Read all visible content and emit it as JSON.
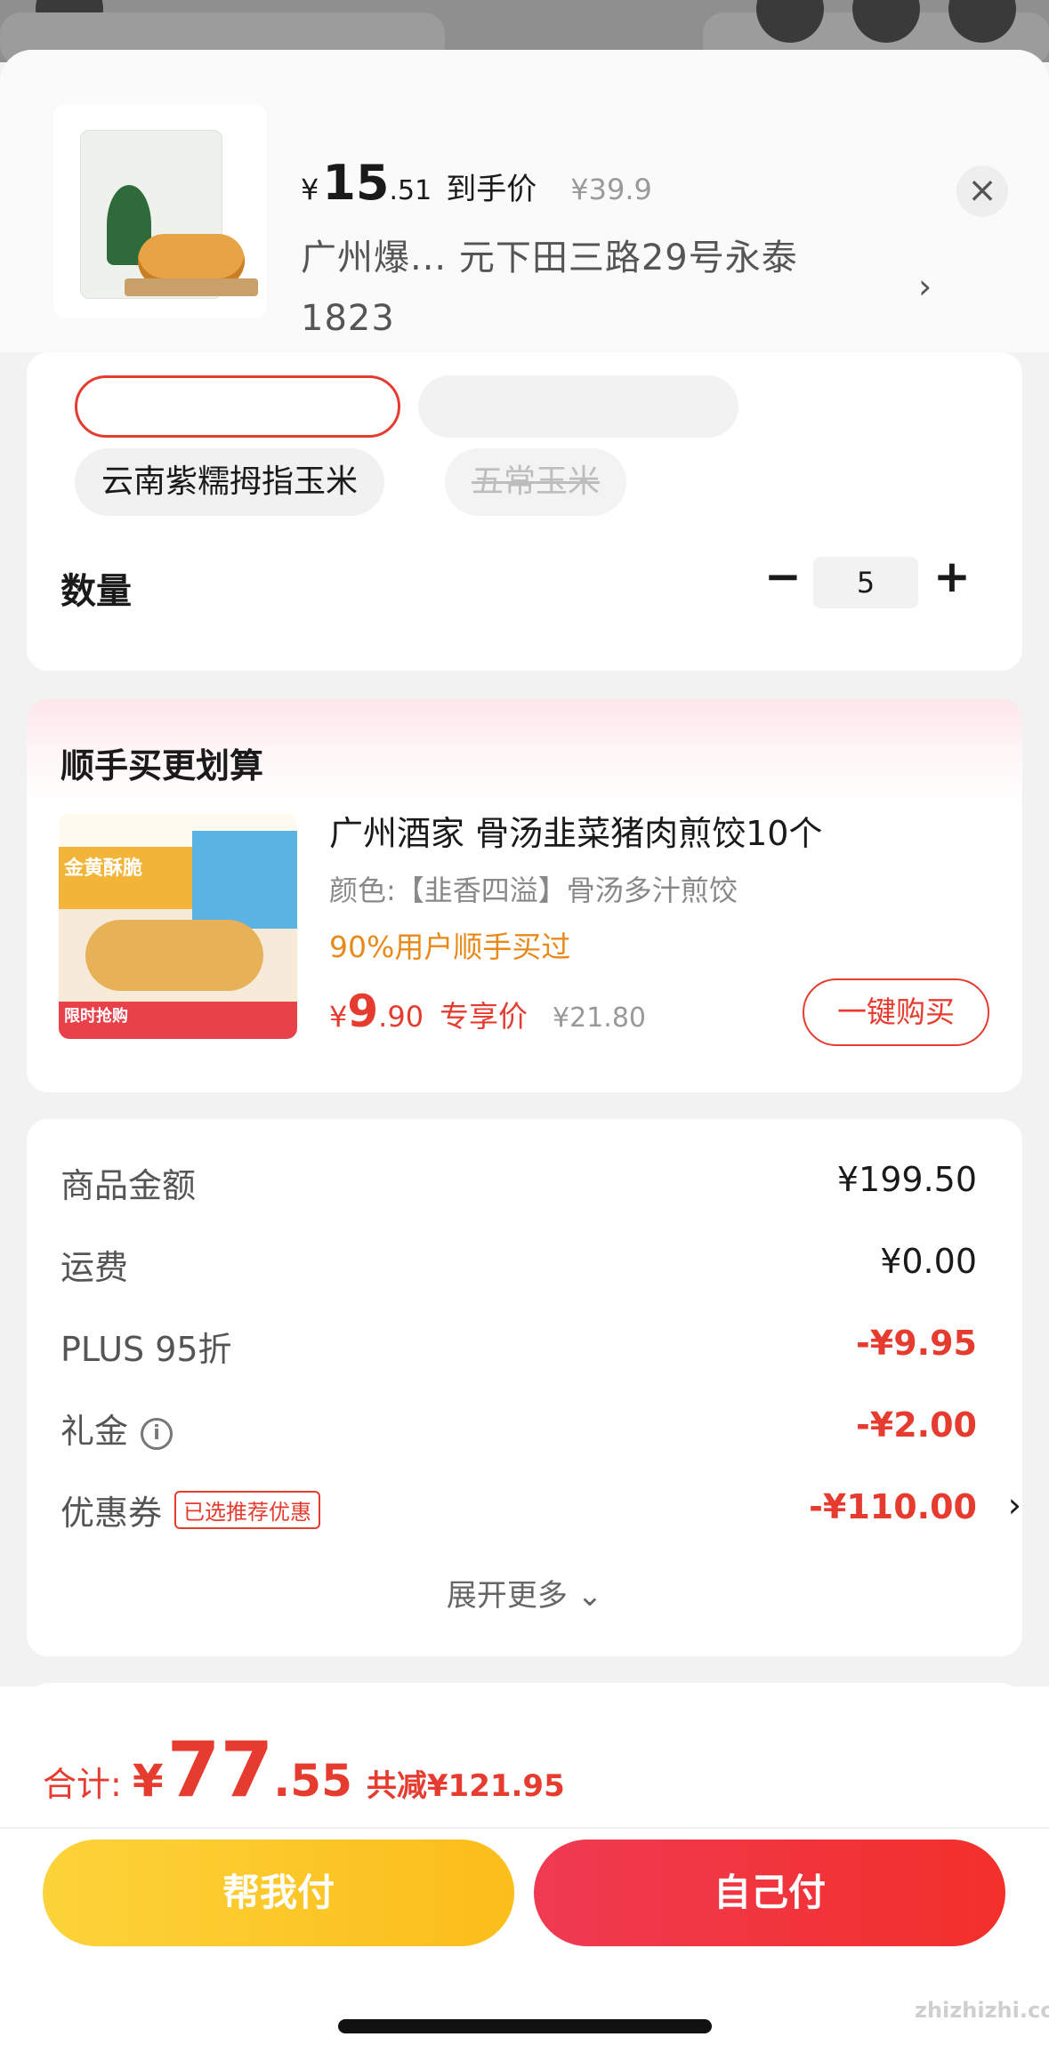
{
  "header": {
    "price_symbol": "¥",
    "price_int": "15",
    "price_dec": ".51",
    "price_tag": "到手价",
    "orig_price": "¥39.9",
    "address": "广州爆...  元下田三路29号永泰1823",
    "close": "×",
    "chevron": "›"
  },
  "spec": {
    "options": [
      {
        "label": "云南紫糯拇指玉米",
        "disabled": false
      },
      {
        "label": "五常玉米",
        "disabled": true
      }
    ],
    "qty_label": "数量",
    "qty_minus": "−",
    "qty_value": "5",
    "qty_plus": "+"
  },
  "addon": {
    "title": "顺手买更划算",
    "image_lines": [
      "金黄酥脆",
      "限时抢购"
    ],
    "name": "广州酒家 骨汤韭菜猪肉煎饺10个",
    "spec": "颜色:【韭香四溢】骨汤多汁煎饺",
    "percent_text": "90%用户顺手买过",
    "price_symbol": "¥",
    "price_int": "9",
    "price_dec": ".90",
    "price_tag": "专享价",
    "orig_price": "¥21.80",
    "buy_button": "一键购买"
  },
  "price_detail": {
    "rows": [
      {
        "label": "商品金额",
        "value": "¥199.50"
      },
      {
        "label": "运费",
        "value": "¥0.00"
      },
      {
        "label": "PLUS 95折",
        "value": "-¥9.95"
      },
      {
        "label": "礼金",
        "value": "-¥2.00"
      },
      {
        "label": "优惠券",
        "value": "-¥110.00"
      }
    ],
    "info_icon": "i",
    "coupon_badge": "已选推荐优惠",
    "coupon_chevron": "›",
    "expand": "展开更多 ⌄"
  },
  "footer": {
    "total_label": "合计:",
    "total_symbol": "¥",
    "total_int": "77",
    "total_dec": ".55",
    "saved": "共减¥121.95",
    "btn_friend": "帮我付",
    "btn_self": "自己付",
    "watermark": "zhizhizhi.com"
  },
  "colors": {
    "accent_red": "#e63c2f",
    "orange_text": "#e88a1a",
    "yellow_button": "#fcd33a"
  }
}
